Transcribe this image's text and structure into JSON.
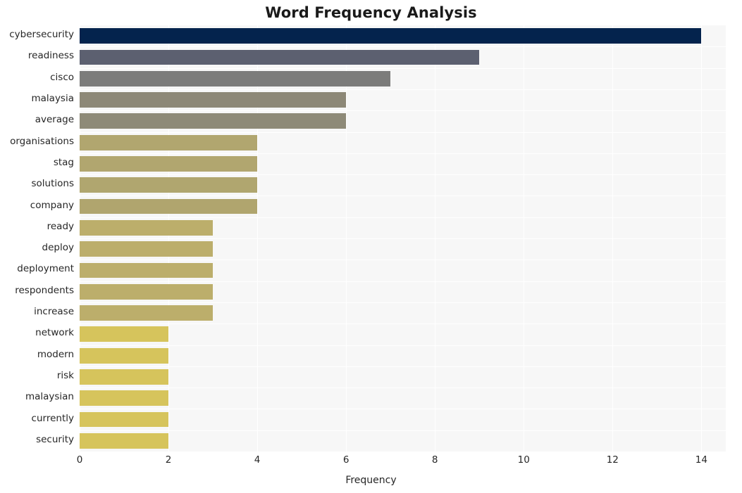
{
  "chart_data": {
    "type": "bar",
    "orientation": "horizontal",
    "title": "Word Frequency Analysis",
    "xlabel": "Frequency",
    "ylabel": "",
    "xlim": [
      0,
      14.55
    ],
    "xticks": [
      0,
      2,
      4,
      6,
      8,
      10,
      12,
      14
    ],
    "xtick_labels": [
      "0",
      "2",
      "4",
      "6",
      "8",
      "10",
      "12",
      "14"
    ],
    "grid": true,
    "grid_axis": "both",
    "legend": "none",
    "background": "#f7f7f7",
    "categories": [
      "cybersecurity",
      "readiness",
      "cisco",
      "malaysia",
      "average",
      "organisations",
      "stag",
      "solutions",
      "company",
      "ready",
      "deploy",
      "deployment",
      "respondents",
      "increase",
      "network",
      "modern",
      "risk",
      "malaysian",
      "currently",
      "security"
    ],
    "values": [
      14,
      9,
      7,
      6,
      6,
      4,
      4,
      4,
      4,
      3,
      3,
      3,
      3,
      3,
      2,
      2,
      2,
      2,
      2,
      2
    ],
    "bar_colors": [
      "#04234d",
      "#5c6070",
      "#7c7c7b",
      "#8d8877",
      "#8e8a78",
      "#b1a66f",
      "#b1a66f",
      "#b0a66f",
      "#b0a56e",
      "#bcae6b",
      "#bcae6b",
      "#bcae6b",
      "#bcae6b",
      "#bcae6b",
      "#d6c45c",
      "#d6c45c",
      "#d6c45c",
      "#d6c45c",
      "#d6c45c",
      "#d6c45c"
    ]
  }
}
